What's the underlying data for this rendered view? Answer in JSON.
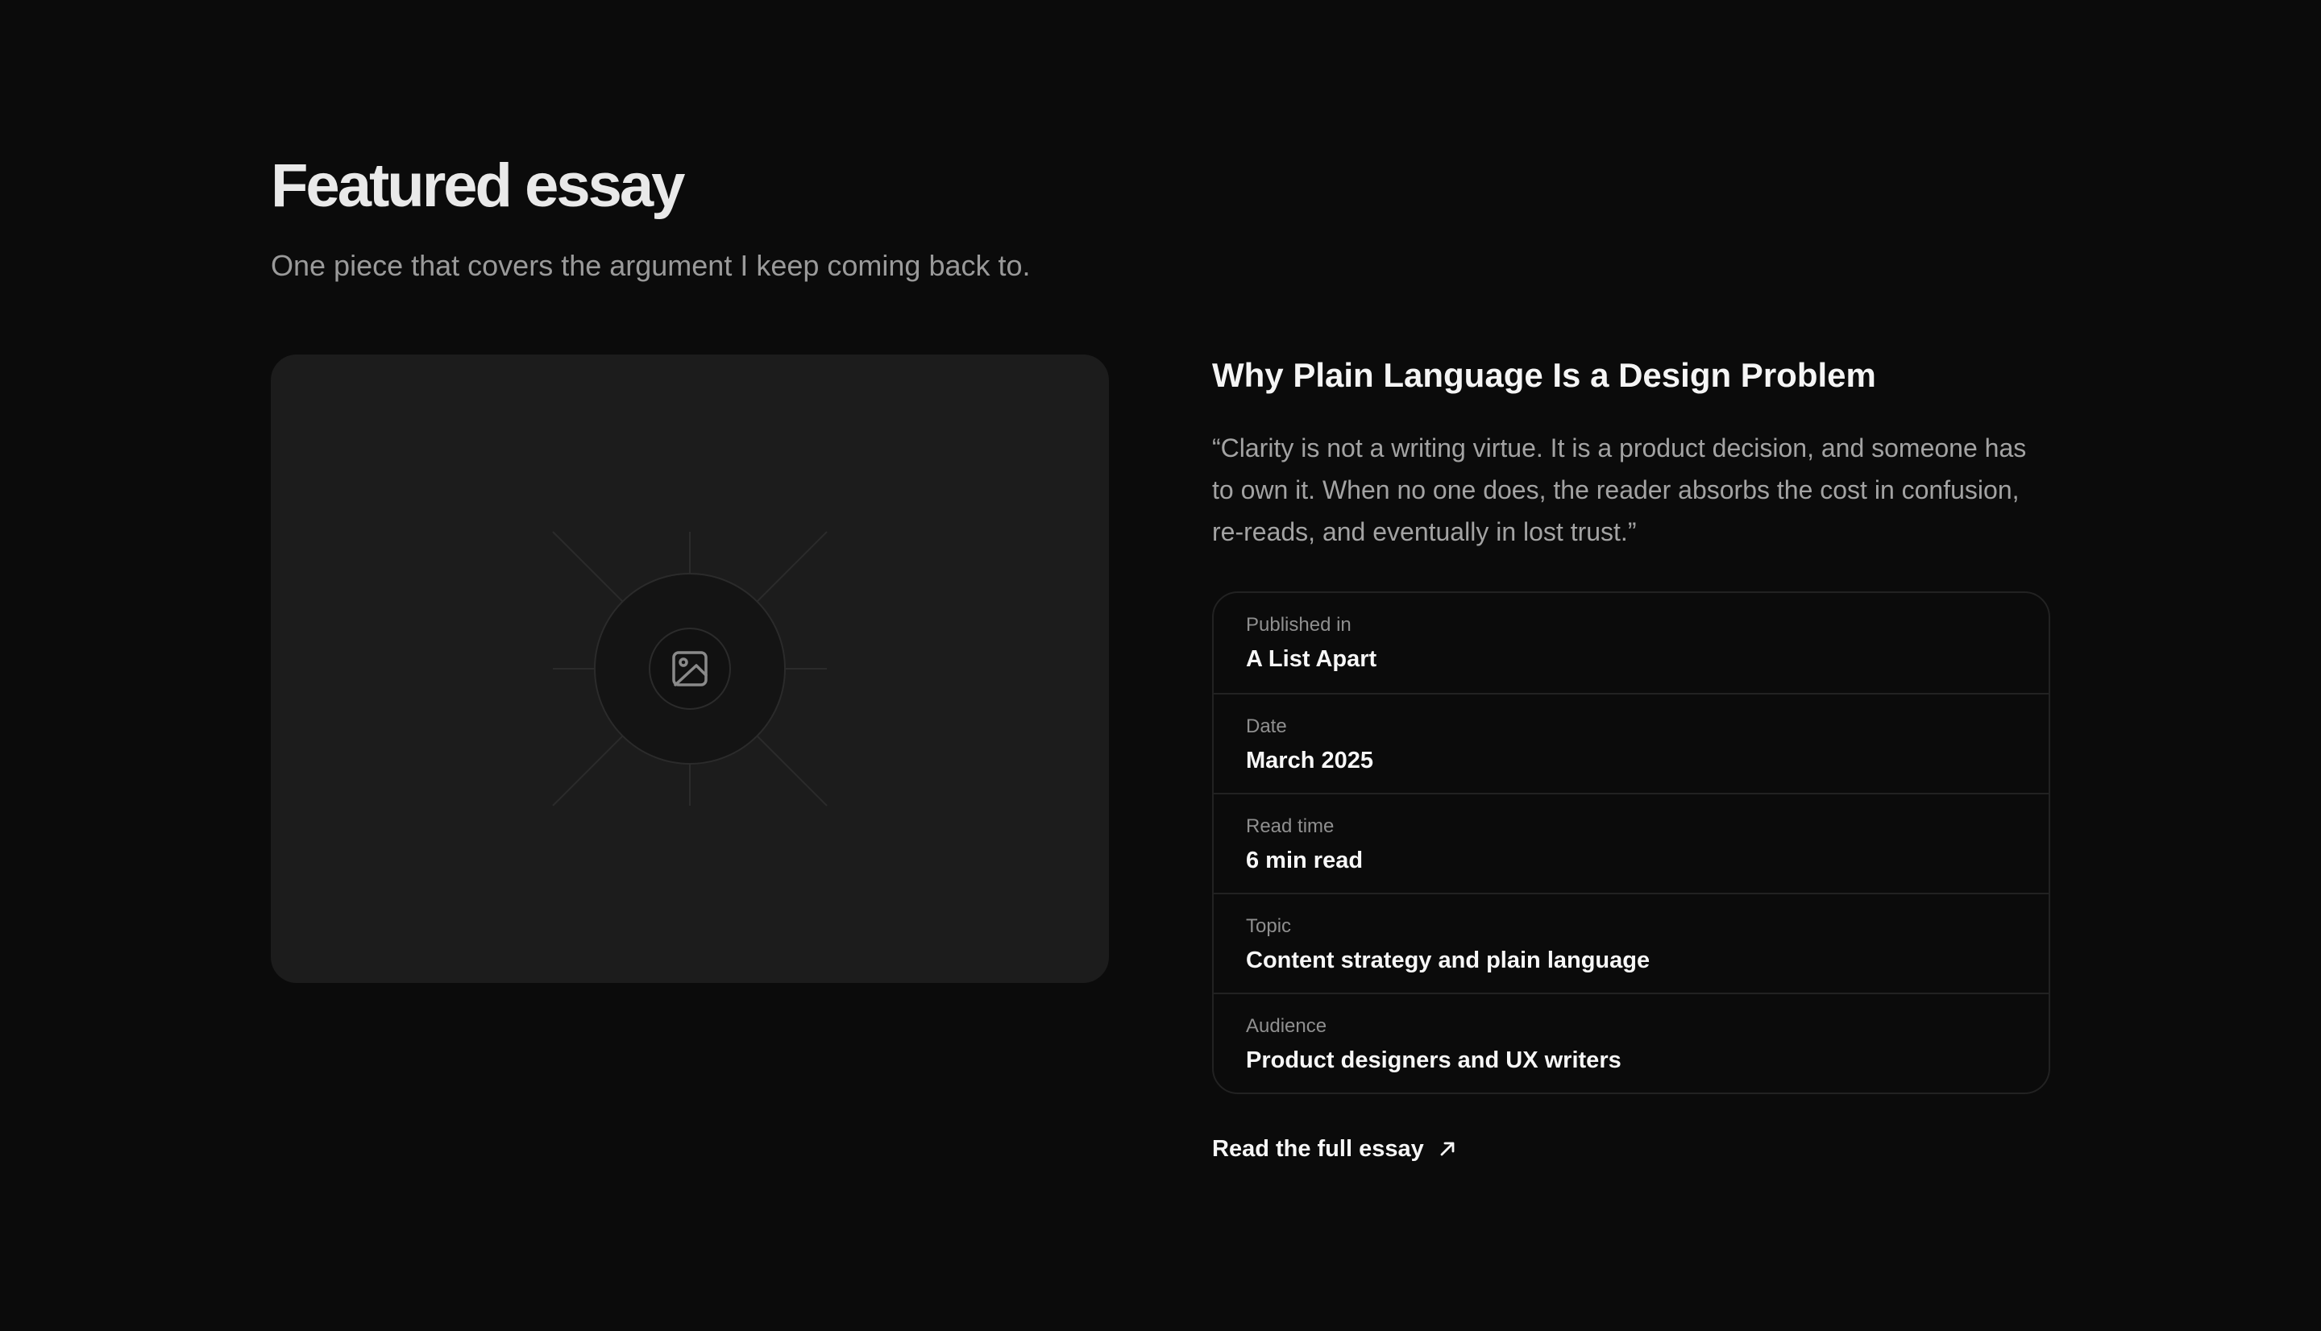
{
  "section": {
    "title": "Featured essay",
    "subtitle": "One piece that covers the argument I keep coming back to."
  },
  "media": {
    "icon": "image-icon",
    "background": "#1c1c1c"
  },
  "article": {
    "title": "Why Plain Language Is a Design Problem",
    "quote": "“Clarity is not a writing virtue. It is a product decision, and someone has to own it. When no one does, the reader absorbs the cost in confusion, re-reads, and eventually in lost trust.”",
    "meta": [
      {
        "label": "Published in",
        "value": "A List Apart"
      },
      {
        "label": "Date",
        "value": "March 2025"
      },
      {
        "label": "Read time",
        "value": "6 min read"
      },
      {
        "label": "Topic",
        "value": "Content strategy and plain language"
      },
      {
        "label": "Audience",
        "value": "Product designers and UX writers"
      }
    ],
    "link_label": "Read the full essay",
    "link_icon": "arrow-up-right-icon"
  },
  "colors": {
    "background": "#0b0b0b",
    "card": "#1c1c1c",
    "border": "#222222",
    "muted_text": "#9a9a9a"
  }
}
